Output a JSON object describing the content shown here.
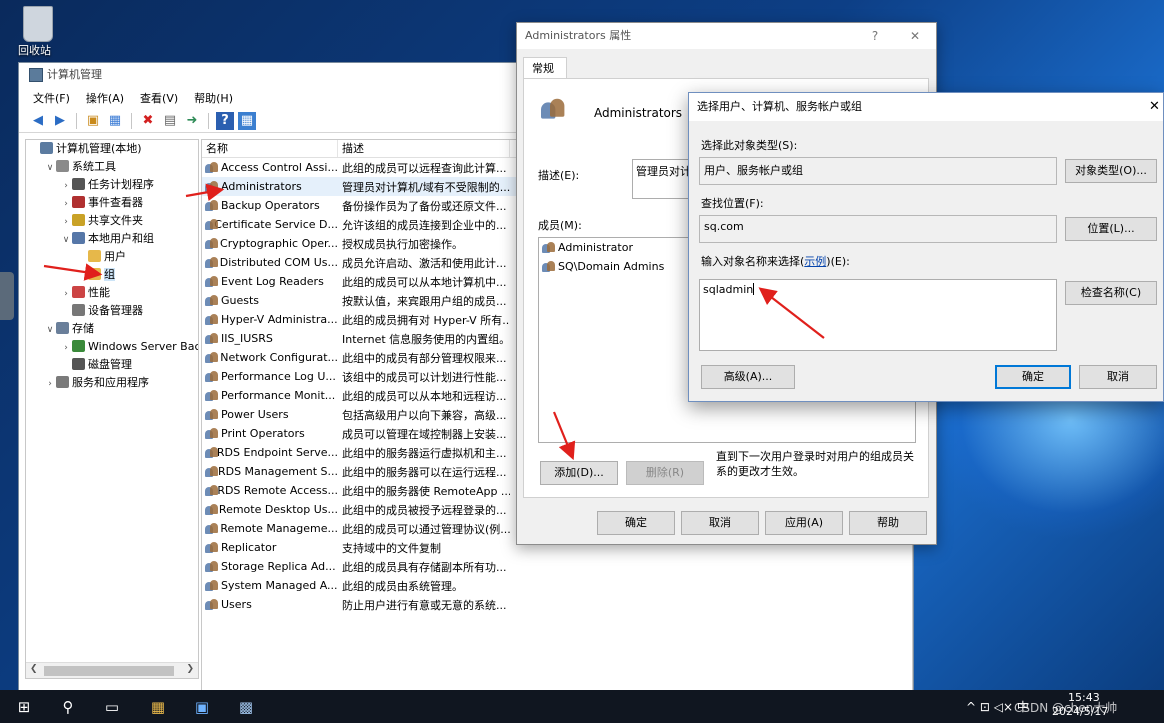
{
  "desktop": {
    "recycle_label": "回收站",
    "watermark": "CSDN @chen大帅"
  },
  "cm": {
    "title": "计算机管理",
    "menu": [
      "文件(F)",
      "操作(A)",
      "查看(V)",
      "帮助(H)"
    ],
    "tree": [
      {
        "label": "计算机管理(本地)",
        "level": 0,
        "chevron": "",
        "icon": "computer"
      },
      {
        "label": "系统工具",
        "level": 1,
        "chevron": "v",
        "icon": "tools"
      },
      {
        "label": "任务计划程序",
        "level": 2,
        "chevron": ">",
        "icon": "clock"
      },
      {
        "label": "事件查看器",
        "level": 2,
        "chevron": ">",
        "icon": "event"
      },
      {
        "label": "共享文件夹",
        "level": 2,
        "chevron": ">",
        "icon": "share"
      },
      {
        "label": "本地用户和组",
        "level": 2,
        "chevron": "v",
        "icon": "users"
      },
      {
        "label": "用户",
        "level": 3,
        "chevron": "",
        "icon": "folder"
      },
      {
        "label": "组",
        "level": 3,
        "chevron": "",
        "icon": "folder",
        "selected": true
      },
      {
        "label": "性能",
        "level": 2,
        "chevron": ">",
        "icon": "perf"
      },
      {
        "label": "设备管理器",
        "level": 2,
        "chevron": "",
        "icon": "device"
      },
      {
        "label": "存储",
        "level": 1,
        "chevron": "v",
        "icon": "storage"
      },
      {
        "label": "Windows Server Backup",
        "level": 2,
        "chevron": ">",
        "icon": "backup"
      },
      {
        "label": "磁盘管理",
        "level": 2,
        "chevron": "",
        "icon": "disk"
      },
      {
        "label": "服务和应用程序",
        "level": 1,
        "chevron": ">",
        "icon": "services"
      }
    ],
    "columns": [
      "名称",
      "描述"
    ],
    "groups": [
      {
        "name": "Access Control Assi...",
        "desc": "此组的成员可以远程查询此计算..."
      },
      {
        "name": "Administrators",
        "desc": "管理员对计算机/域有不受限制的...",
        "selected": true
      },
      {
        "name": "Backup Operators",
        "desc": "备份操作员为了备份或还原文件..."
      },
      {
        "name": "Certificate Service D...",
        "desc": "允许该组的成员连接到企业中的..."
      },
      {
        "name": "Cryptographic Oper...",
        "desc": "授权成员执行加密操作。"
      },
      {
        "name": "Distributed COM Us...",
        "desc": "成员允许启动、激活和使用此计..."
      },
      {
        "name": "Event Log Readers",
        "desc": "此组的成员可以从本地计算机中..."
      },
      {
        "name": "Guests",
        "desc": "按默认值，来宾跟用户组的成员..."
      },
      {
        "name": "Hyper-V Administra...",
        "desc": "此组的成员拥有对 Hyper-V 所有..."
      },
      {
        "name": "IIS_IUSRS",
        "desc": "Internet 信息服务使用的内置组。"
      },
      {
        "name": "Network Configurat...",
        "desc": "此组中的成员有部分管理权限来..."
      },
      {
        "name": "Performance Log U...",
        "desc": "该组中的成员可以计划进行性能..."
      },
      {
        "name": "Performance Monit...",
        "desc": "此组的成员可以从本地和远程访..."
      },
      {
        "name": "Power Users",
        "desc": "包括高级用户以向下兼容，高级..."
      },
      {
        "name": "Print Operators",
        "desc": "成员可以管理在域控制器上安装..."
      },
      {
        "name": "RDS Endpoint Serve...",
        "desc": "此组中的服务器运行虚拟机和主..."
      },
      {
        "name": "RDS Management S...",
        "desc": "此组中的服务器可以在运行远程..."
      },
      {
        "name": "RDS Remote Access...",
        "desc": "此组中的服务器使 RemoteApp ..."
      },
      {
        "name": "Remote Desktop Us...",
        "desc": "此组中的成员被授予远程登录的..."
      },
      {
        "name": "Remote Manageme...",
        "desc": "此组的成员可以通过管理协议(例..."
      },
      {
        "name": "Replicator",
        "desc": "支持域中的文件复制"
      },
      {
        "name": "Storage Replica Ad...",
        "desc": "此组的成员具有存储副本所有功..."
      },
      {
        "name": "System Managed A...",
        "desc": "此组的成员由系统管理。"
      },
      {
        "name": "Users",
        "desc": "防止用户进行有意或无意的系统..."
      }
    ]
  },
  "props": {
    "title": "Administrators 属性",
    "help": "?",
    "close": "✕",
    "tab": "常规",
    "group_name": "Administrators",
    "desc_label": "描述(E):",
    "desc_value": "管理员对计",
    "members_label": "成员(M):",
    "members": [
      "Administrator",
      "SQ\\Domain Admins"
    ],
    "add_button": "添加(D)...",
    "remove_button": "删除(R)",
    "note": "直到下一次用户登录时对用户的组成员关系的更改才生效。",
    "ok": "确定",
    "cancel": "取消",
    "apply": "应用(A)",
    "help_button": "帮助"
  },
  "select": {
    "title": "选择用户、计算机、服务帐户或组",
    "close": "✕",
    "type_label": "选择此对象类型(S):",
    "type_value": "用户、服务帐户或组",
    "type_button": "对象类型(O)...",
    "loc_label": "查找位置(F):",
    "loc_value": "sq.com",
    "loc_button": "位置(L)...",
    "name_label_pre": "输入对象名称来选择(",
    "name_label_link": "示例",
    "name_label_post": ")(E):",
    "name_value": "sqladmin",
    "check_button": "检查名称(C)",
    "advanced": "高级(A)...",
    "ok": "确定",
    "cancel": "取消"
  },
  "taskbar": {
    "time": "15:43",
    "date": "2024/5/17",
    "tray": "^ ⊡ ◁× 中"
  },
  "colors": {
    "arrow": "#e0201c",
    "accent": "#0078d7",
    "selection": "#e5f0fb"
  }
}
